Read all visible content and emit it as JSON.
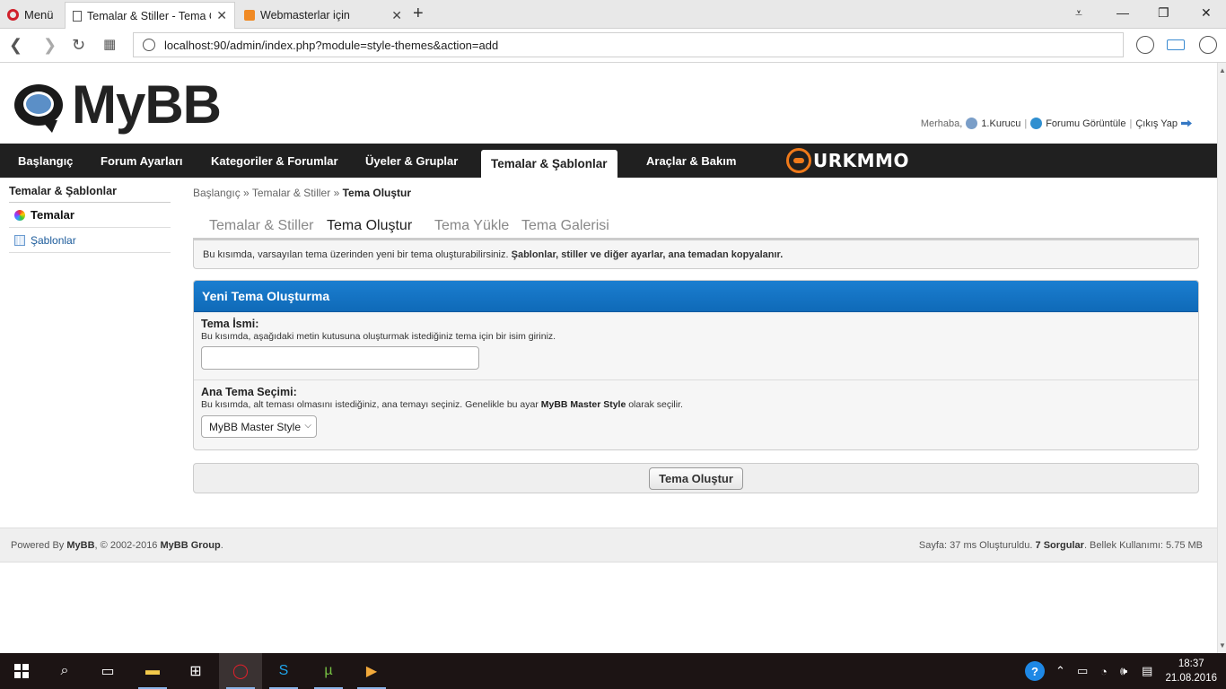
{
  "browser": {
    "menu_label": "Menü",
    "tabs": [
      {
        "label": "Temalar & Stiller - Tema Ol",
        "active": true
      },
      {
        "label": "Webmasterlar için",
        "active": false
      }
    ],
    "url": "localhost:90/admin/index.php?module=style-themes&action=add"
  },
  "header": {
    "logo_text": "MyBB",
    "welcome": "Merhaba,",
    "user": "1.Kurucu",
    "view_forum": "Forumu Görüntüle",
    "logout": "Çıkış Yap"
  },
  "nav": {
    "items": [
      {
        "label": "Başlangıç"
      },
      {
        "label": "Forum Ayarları"
      },
      {
        "label": "Kategoriler & Forumlar"
      },
      {
        "label": "Üyeler & Gruplar"
      },
      {
        "label": "Temalar & Şablonlar",
        "active": true
      },
      {
        "label": "Araçlar & Bakım"
      }
    ],
    "brand": "URKMMO"
  },
  "sidebar": {
    "title": "Temalar & Şablonlar",
    "items": [
      {
        "label": "Temalar",
        "icon": "themes-icon",
        "active": true
      },
      {
        "label": "Şablonlar",
        "icon": "templates-icon"
      }
    ]
  },
  "breadcrumb": {
    "items": [
      "Başlangıç",
      "Temalar & Stiller"
    ],
    "separator": "»",
    "current": "Tema Oluştur"
  },
  "subtabs": [
    {
      "label": "Temalar & Stiller"
    },
    {
      "label": "Tema Oluştur",
      "active": true
    },
    {
      "label": "Tema Yükle"
    },
    {
      "label": "Tema Galerisi"
    }
  ],
  "notice": {
    "text": "Bu kısımda, varsayılan tema üzerinden yeni bir tema oluşturabilirsiniz.",
    "bold": "Şablonlar, stiller ve diğer ayarlar, ana temadan kopyalanır."
  },
  "form": {
    "title": "Yeni Tema Oluşturma",
    "name_label": "Tema İsmi:",
    "name_desc": "Bu kısımda, aşağıdaki metin kutusuna oluşturmak istediğiniz tema için bir isim giriniz.",
    "name_value": "",
    "parent_label": "Ana Tema Seçimi:",
    "parent_desc_pre": "Bu kısımda, alt teması olmasını istediğiniz, ana temayı seçiniz. Genelikle bu ayar",
    "parent_desc_bold": "MyBB Master Style",
    "parent_desc_post": "olarak seçilir.",
    "parent_selected": "MyBB Master Style",
    "submit": "Tema Oluştur"
  },
  "footer": {
    "powered_pre": "Powered By",
    "powered_brand": "MyBB",
    "copyright": ", © 2002-2016",
    "group": "MyBB Group",
    "stats_pre": "Sayfa: 37 ms Oluşturuldu.",
    "queries": "7 Sorgular",
    "memory": ". Bellek Kullanımı: 5.75 MB"
  },
  "taskbar": {
    "time": "18:37",
    "date": "21.08.2016"
  },
  "colors": {
    "nav_bg": "#202020",
    "form_header": "#1676c8",
    "brand_orange": "#f07a1a"
  }
}
